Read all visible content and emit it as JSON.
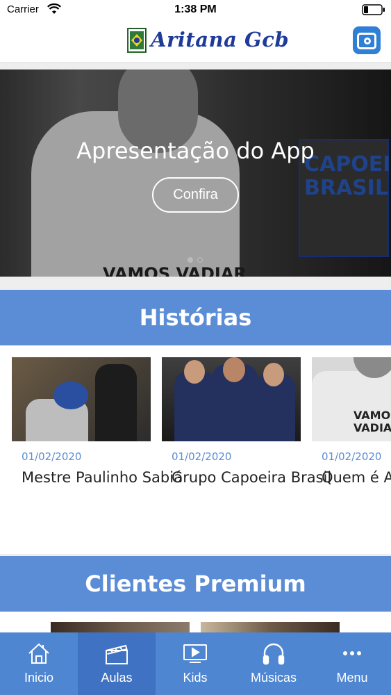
{
  "status_bar": {
    "carrier": "Carrier",
    "time": "1:38 PM",
    "icons": [
      "wifi-icon",
      "battery-icon"
    ]
  },
  "header": {
    "title": "Aritana Gcb",
    "logo": "capoeira-brasil-logo",
    "action_icon": "instagram-icon"
  },
  "hero": {
    "title": "Apresentação do App",
    "button_label": "Confira",
    "shirt_text": "VAMOS VADIAR",
    "badge_text": "CAPOEIRA BRASIL",
    "slides_total": 2,
    "active_slide": 1
  },
  "sections": {
    "historias_title": "Histórias",
    "premium_title": "Clientes Premium"
  },
  "historias": [
    {
      "date": "01/02/2020",
      "title": "Mestre Paulinho Sabiá"
    },
    {
      "date": "01/02/2020",
      "title": "Grupo Capoeira Brasil"
    },
    {
      "date": "01/02/2020",
      "title": "Quem é Aritana"
    }
  ],
  "tabbar": {
    "items": [
      {
        "label": "Inicio",
        "icon": "home-icon"
      },
      {
        "label": "Aulas",
        "icon": "clapperboard-icon"
      },
      {
        "label": "Kids",
        "icon": "play-screen-icon"
      },
      {
        "label": "Músicas",
        "icon": "headphones-icon"
      },
      {
        "label": "Menu",
        "icon": "more-dots-icon"
      }
    ],
    "active_index": 1
  },
  "colors": {
    "accent": "#5b8dd6",
    "tabbar": "#4f86d2",
    "tab_active": "#3f72c2",
    "brand_text": "#1e3b9a"
  }
}
